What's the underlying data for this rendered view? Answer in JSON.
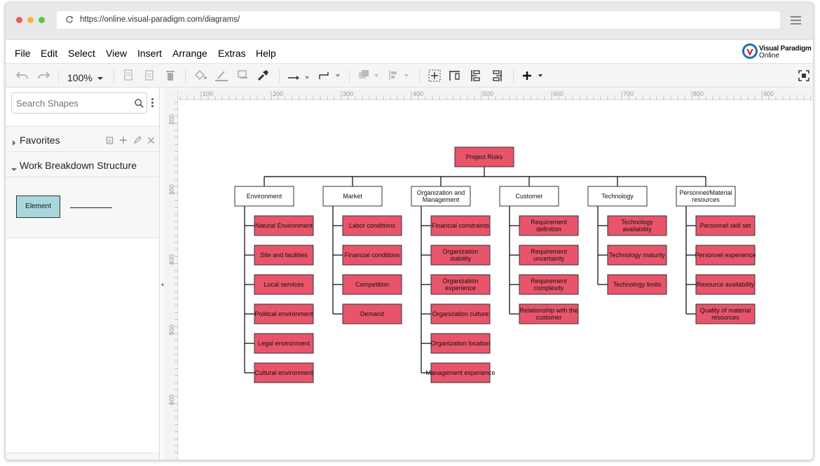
{
  "browser": {
    "url": "https://online.visual-paradigm.com/diagrams/",
    "dot_colors": [
      "#ed5d56",
      "#f4b63c",
      "#5ec34c"
    ]
  },
  "menu": [
    "File",
    "Edit",
    "Select",
    "View",
    "Insert",
    "Arrange",
    "Extras",
    "Help"
  ],
  "brand": {
    "line1": "Visual Paradigm",
    "line2": "Online"
  },
  "toolbar": {
    "zoom": "100%"
  },
  "sidebar": {
    "search_placeholder": "Search Shapes",
    "favorites_label": "Favorites",
    "section_label": "Work Breakdown Structure",
    "element_label": "Element"
  },
  "rulers": {
    "top": [
      "100",
      "200",
      "300",
      "400",
      "500",
      "600",
      "700",
      "800",
      "900"
    ],
    "left": [
      "200",
      "300",
      "400",
      "500",
      "600"
    ]
  },
  "diagram": {
    "root": "Project Risks",
    "colors": {
      "leaf_fill": "#e8556a",
      "category_fill": "#ffffff",
      "line": "#000000"
    },
    "categories": [
      {
        "label": "Environment",
        "items": [
          "Natural Environment",
          "Site and facilities",
          "Local services",
          "Political environment",
          "Legal environment",
          "Cultural environment"
        ]
      },
      {
        "label": "Market",
        "items": [
          "Labor conditions",
          "Financial conditions",
          "Competition",
          "Demand"
        ]
      },
      {
        "label": "Organization and Management",
        "items": [
          "Financial constraints",
          "Organization stability",
          "Organization experience",
          "Organization culture",
          "Organization location",
          "Management experience"
        ]
      },
      {
        "label": "Customer",
        "items": [
          "Requirement definition",
          "Requirement uncertainty",
          "Requirement complexity",
          "Relationship with the customer"
        ]
      },
      {
        "label": "Technology",
        "items": [
          "Technology availability",
          "Technology maturity",
          "Technology limits"
        ]
      },
      {
        "label": "Personnel/Material resources",
        "items": [
          "Personnel skill set",
          "Personnel experience",
          "Resource availability",
          "Quality of material resources"
        ]
      }
    ]
  }
}
